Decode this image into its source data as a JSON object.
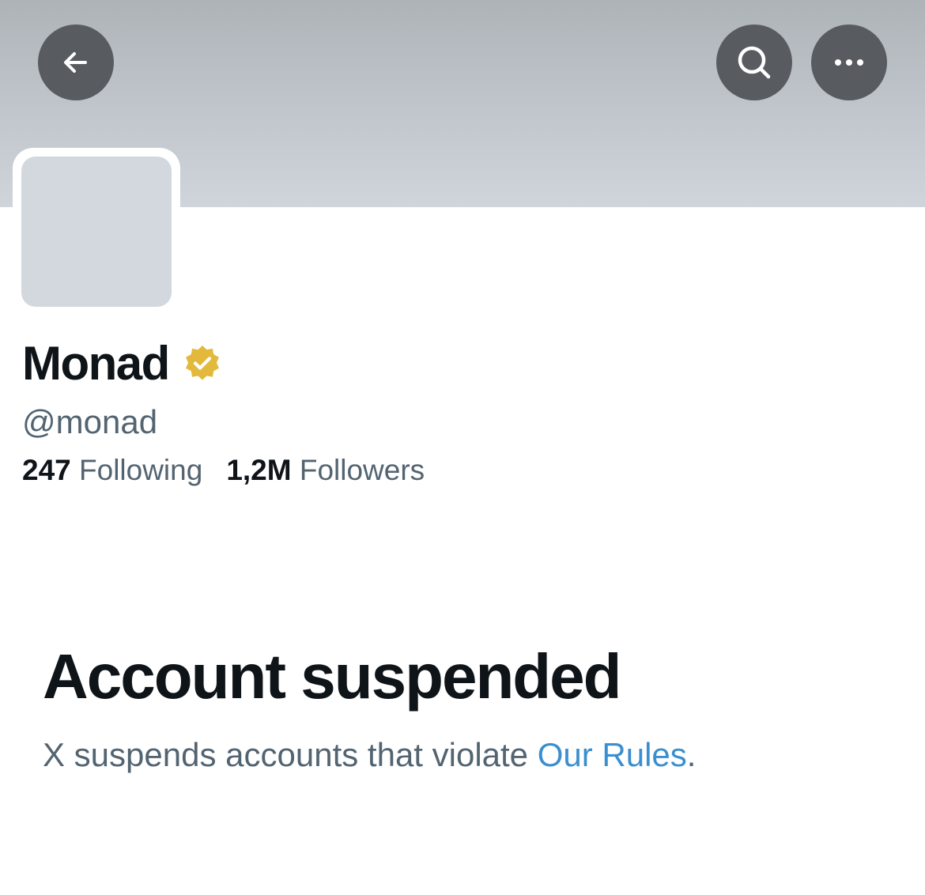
{
  "header": {
    "back_icon": "arrow-left-icon",
    "search_icon": "search-icon",
    "more_icon": "more-horizontal-icon",
    "button_color": "#585c60"
  },
  "profile": {
    "display_name": "Monad",
    "verified_badge_color": "#e2b93b",
    "handle": "@monad",
    "following_count": "247",
    "following_label": "Following",
    "followers_count": "1,2M",
    "followers_label": "Followers"
  },
  "suspension": {
    "title": "Account suspended",
    "message_prefix": "X suspends accounts that violate ",
    "link_text": "Our Rules",
    "message_suffix": ".",
    "link_color": "#3a8fd0"
  }
}
